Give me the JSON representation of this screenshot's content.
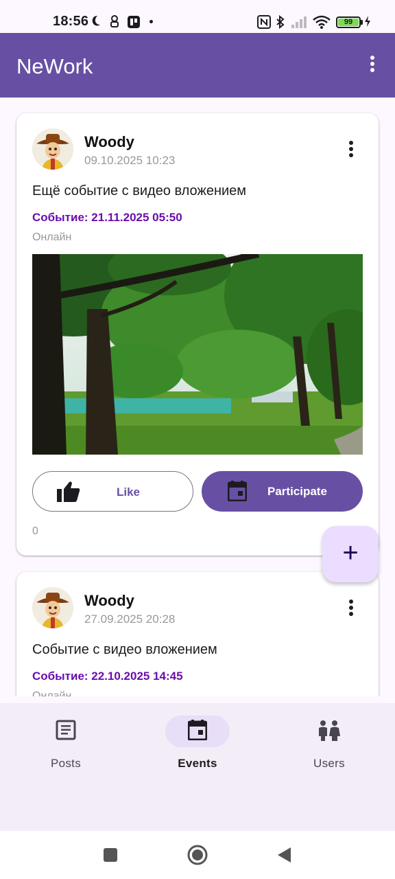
{
  "status_bar": {
    "time": "18:56",
    "battery": "99",
    "icons": [
      "moon-icon",
      "notification-icon",
      "app-icon",
      "nfc-icon",
      "bluetooth-icon",
      "signal-icon",
      "wifi-icon",
      "charging-icon"
    ]
  },
  "app_bar": {
    "title": "NeWork",
    "menu_icon": "more-vert-icon"
  },
  "events": [
    {
      "author": "Woody",
      "published": "09.10.2025 10:23",
      "content": "Ещё событие с видео вложением",
      "event_date": "Событие: 21.11.2025 05:50",
      "event_type": "Онлайн",
      "like_label": "Like",
      "participate_label": "Participate",
      "likes_count": "0"
    },
    {
      "author": "Woody",
      "published": "27.09.2025 20:28",
      "content": "Событие с видео вложением",
      "event_date": "Событие: 22.10.2025 14:45",
      "event_type": "Онлайн"
    }
  ],
  "fab": {
    "label": "+",
    "icon": "add-icon"
  },
  "bottom_nav": {
    "items": [
      {
        "label": "Posts",
        "icon": "article-icon",
        "active": false
      },
      {
        "label": "Events",
        "icon": "calendar-icon",
        "active": true
      },
      {
        "label": "Users",
        "icon": "people-icon",
        "active": false
      }
    ]
  },
  "colors": {
    "primary": "#6750a4",
    "event_accent": "#6a0dad",
    "fab_bg": "#eaddff",
    "nav_bg": "#f3edf7"
  }
}
